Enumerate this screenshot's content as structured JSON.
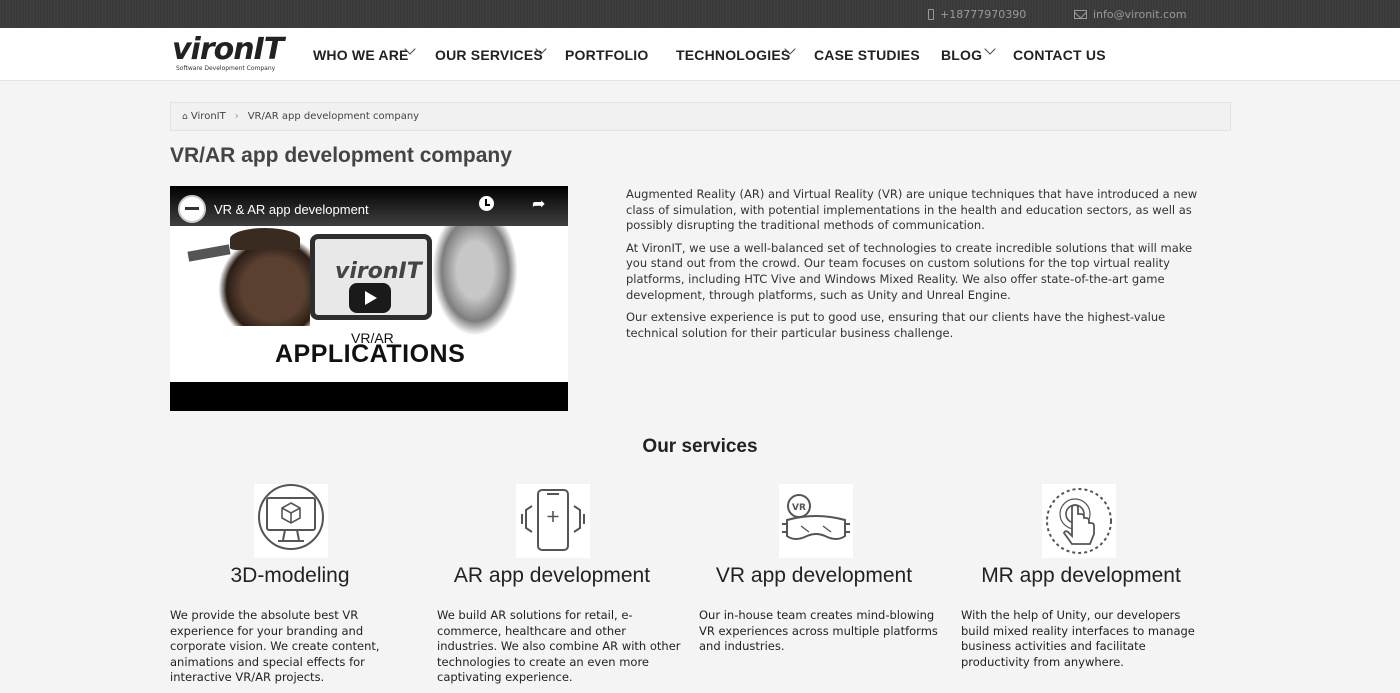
{
  "topbar": {
    "phone": "+18777970390",
    "email": "info@vironit.com"
  },
  "header": {
    "logo_text": "vironIT",
    "logo_tagline": "Software Development Company",
    "nav": [
      {
        "label": "WHO WE ARE",
        "has_dropdown": true
      },
      {
        "label": "OUR SERVICES",
        "has_dropdown": true
      },
      {
        "label": "PORTFOLIO",
        "has_dropdown": false
      },
      {
        "label": "TECHNOLOGIES",
        "has_dropdown": true
      },
      {
        "label": "CASE STUDIES",
        "has_dropdown": false
      },
      {
        "label": "BLOG",
        "has_dropdown": true
      },
      {
        "label": "CONTACT US",
        "has_dropdown": false
      }
    ]
  },
  "breadcrumb": {
    "home": "VironIT",
    "current": "VR/AR app development company"
  },
  "page": {
    "title": "VR/AR app development company"
  },
  "video": {
    "title": "VR & AR app development",
    "screen_logo": "vironIT",
    "overlay_small": "VR/AR",
    "overlay_big": "APPLICATIONS"
  },
  "intro": {
    "paragraphs": [
      "Augmented Reality (AR) and Virtual Reality (VR) are unique techniques that have introduced a new class of simulation, with potential implementations in the health and education sectors, as well as possibly disrupting the traditional methods of communication.",
      "At VironIT, we use a well-balanced set of technologies to create incredible solutions that will make you stand out from the crowd. Our team focuses on custom solutions for the top virtual reality platforms, including HTC Vive and Windows Mixed Reality. We also offer state-of-the-art game development, through platforms, such as Unity and Unreal Engine.",
      "Our extensive experience is put to good use, ensuring that our clients have the highest-value technical solution for their particular business challenge."
    ]
  },
  "services": {
    "title": "Our services",
    "items": [
      {
        "name": "3D-modeling",
        "icon": "monitor-cube-icon",
        "description": "We provide the absolute best VR experience for your branding and corporate vision. We create content, animations and special effects for interactive VR/AR projects."
      },
      {
        "name": "AR app development",
        "icon": "phone-ar-icon",
        "description": "We build AR solutions for retail, e-commerce, healthcare and other industries. We also combine AR with other technologies to create an even more captivating experience."
      },
      {
        "name": "VR app development",
        "icon": "vr-headset-icon",
        "description": "Our in-house team creates mind-blowing VR experiences across multiple platforms and industries."
      },
      {
        "name": "MR app development",
        "icon": "touch-hand-icon",
        "description": "With the help of Unity, our developers build mixed reality interfaces to manage business activities and facilitate productivity from anywhere."
      }
    ]
  }
}
